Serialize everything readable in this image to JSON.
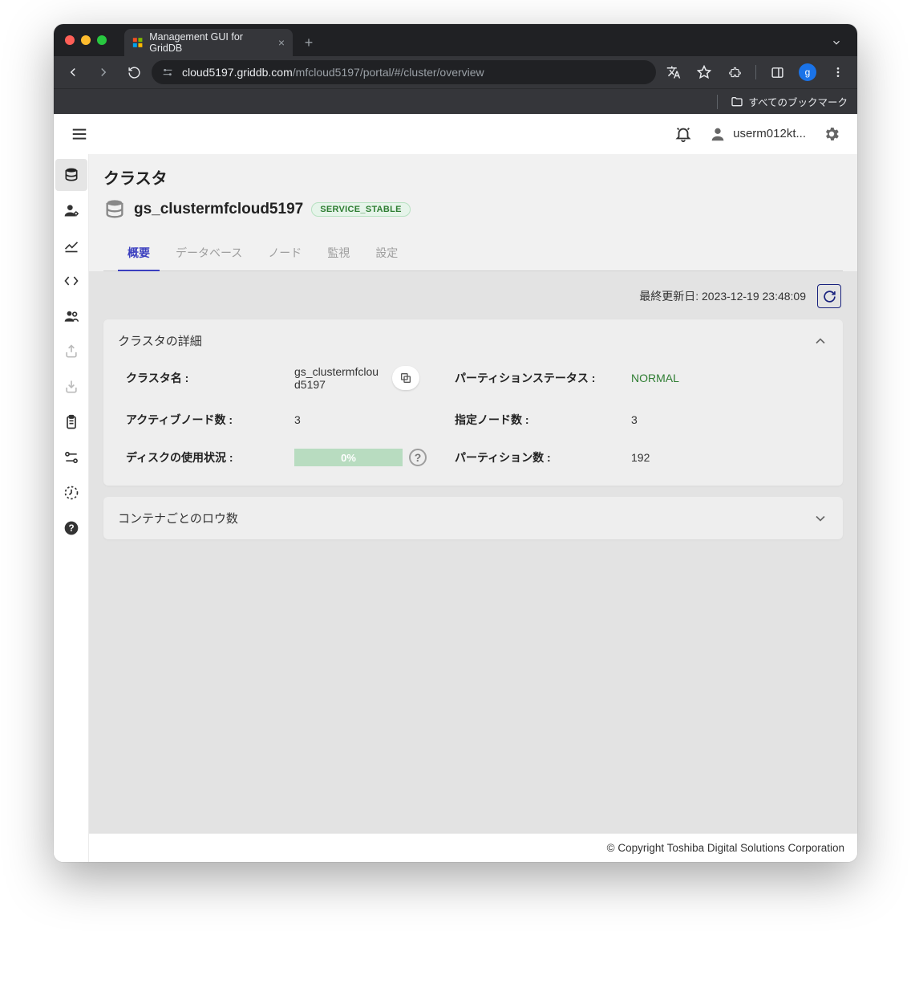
{
  "browser": {
    "tab_title": "Management GUI for GridDB",
    "url_host": "cloud5197.griddb.com",
    "url_path": "/mfcloud5197/portal/#/cluster/overview",
    "avatar_letter": "g",
    "bookmarks_label": "すべてのブックマーク"
  },
  "header": {
    "username": "userm012kt..."
  },
  "page": {
    "title": "クラスタ",
    "cluster_name": "gs_clustermfcloud5197",
    "status_badge": "SERVICE_STABLE"
  },
  "tabs": [
    {
      "label": "概要",
      "active": true
    },
    {
      "label": "データベース",
      "active": false
    },
    {
      "label": "ノード",
      "active": false
    },
    {
      "label": "監視",
      "active": false
    },
    {
      "label": "設定",
      "active": false
    }
  ],
  "status": {
    "last_update_label": "最終更新日: ",
    "last_update_value": "2023-12-19 23:48:09"
  },
  "details": {
    "panel_title": "クラスタの詳細",
    "cluster_name_label": "クラスタ名 :",
    "cluster_name_value": "gs_clustermfcloud5197",
    "partition_status_label": "パーティションステータス :",
    "partition_status_value": "NORMAL",
    "active_nodes_label": "アクティブノード数 :",
    "active_nodes_value": "3",
    "designated_nodes_label": "指定ノード数 :",
    "designated_nodes_value": "3",
    "disk_usage_label": "ディスクの使用状況 :",
    "disk_usage_value": "0%",
    "partition_count_label": "パーティション数 :",
    "partition_count_value": "192"
  },
  "rows_panel": {
    "title": "コンテナごとのロウ数"
  },
  "footer": {
    "copyright": "© Copyright Toshiba Digital Solutions Corporation"
  }
}
